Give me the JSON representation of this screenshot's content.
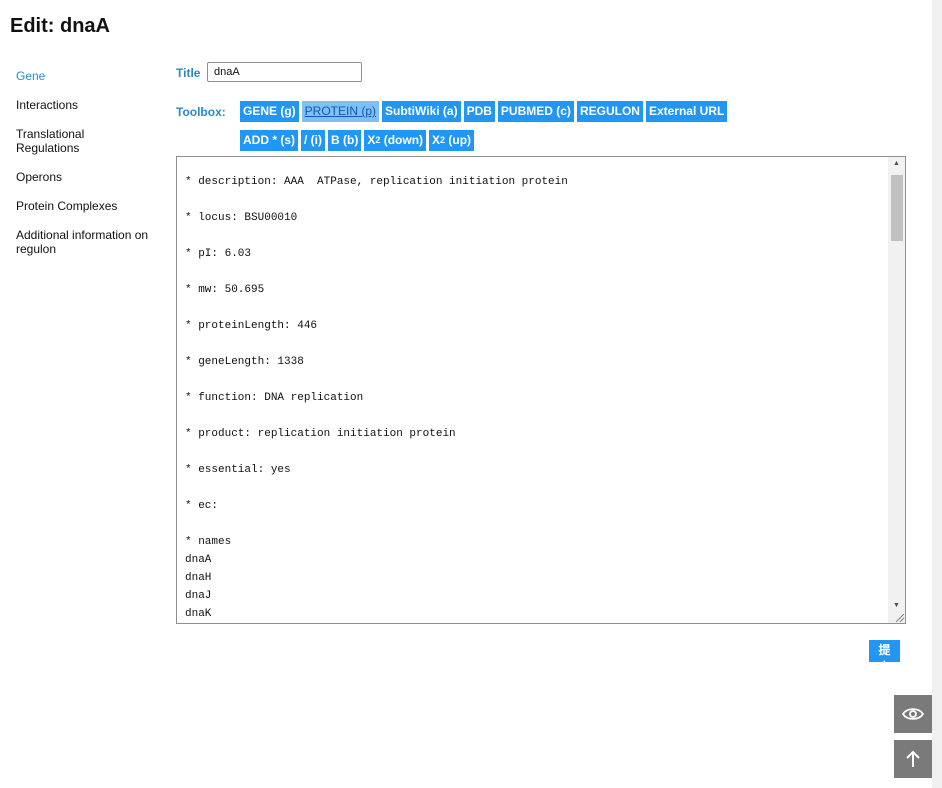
{
  "page": {
    "title": "Edit: dnaA"
  },
  "sidebar": {
    "items": [
      {
        "label": "Gene"
      },
      {
        "label": "Interactions"
      },
      {
        "label": "Translational\nRegulations"
      },
      {
        "label": "Operons"
      },
      {
        "label": "Protein Complexes"
      },
      {
        "label": "Additional information on\nregulon"
      }
    ]
  },
  "form": {
    "title_label": "Title",
    "title_value": "dnaA",
    "toolbox_label": "Toolbox:"
  },
  "toolbar": {
    "gene": "GENE (g)",
    "protein": "PROTEIN (p)",
    "subtiwiki": "SubtiWiki (a)",
    "pdb": "PDB",
    "pubmed": "PUBMED (c)",
    "regulon": "REGULON",
    "external_url": "External URL",
    "add": "ADD * (s)",
    "italic": "/ (i)",
    "bold": "B (b)",
    "sub_base": "X",
    "sub_script": "2",
    "sub_label": " (down)",
    "sup_base": "X",
    "sup_script": "2",
    "sup_label": " (up)"
  },
  "editor": {
    "content": "* description: AAA  ATPase, replication initiation protein\n\n* locus: BSU00010\n\n* pI: 6.03\n\n* mw: 50.695\n\n* proteinLength: 446\n\n* geneLength: 1338\n\n* function: DNA replication\n\n* product: replication initiation protein\n\n* essential: yes\n\n* ec:\n\n* names\ndnaA\ndnaH\ndnaJ\ndnaK"
  },
  "submit_label": "提交",
  "colors": {
    "accent": "#2196f3",
    "link": "#2b88c9",
    "float_button": "#7a7a7a"
  },
  "icons": {
    "preview": "eye-icon",
    "back_to_top": "arrow-up-icon"
  }
}
